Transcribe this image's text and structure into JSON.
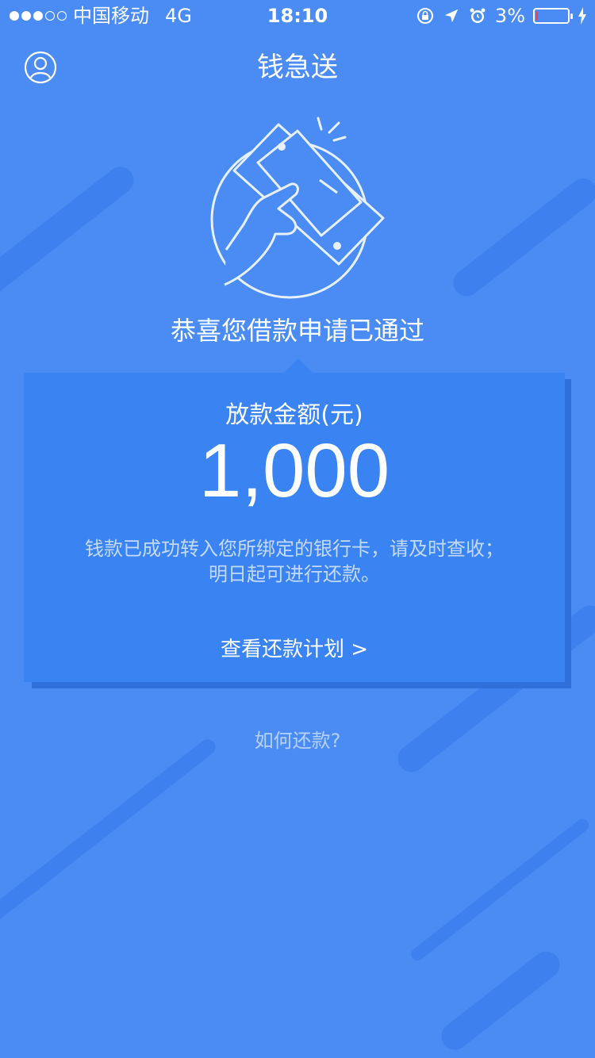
{
  "status_bar": {
    "carrier": "中国移动",
    "network": "4G",
    "time": "18:10",
    "battery_percent": "3%",
    "battery_level": 0.03
  },
  "nav": {
    "title": "钱急送",
    "profile_icon": "user-circle-icon"
  },
  "hero": {
    "icon": "hand-holding-cash-icon",
    "headline": "恭喜您借款申请已通过"
  },
  "card": {
    "amount_label": "放款金额(元)",
    "amount": "1,000",
    "desc_line1": "钱款已成功转入您所绑定的银行卡，请及时查收；",
    "desc_line2": "明日起可进行还款。",
    "repay_plan_link": "查看还款计划 >"
  },
  "footer": {
    "how_to_repay": "如何还款?"
  },
  "colors": {
    "background": "#4a8cf4",
    "card": "#3a83f2",
    "battery_low": "#ff3b30"
  }
}
